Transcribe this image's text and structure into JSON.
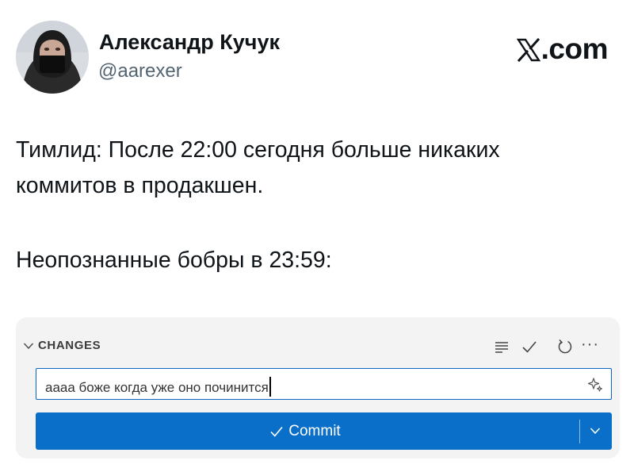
{
  "tweet": {
    "author": {
      "name": "Александр Кучук",
      "handle": "@aarexer"
    },
    "source": {
      "icon": "x-logo-icon",
      "suffix": ".com"
    },
    "text_lines": [
      "Тимлид: После 22:00 сегодня больше никаких",
      "коммитов в продакшен.",
      "Неопознанные бобры в 23:59:"
    ]
  },
  "scm_panel": {
    "section_title": "CHANGES",
    "toolbar": {
      "icons": [
        "view-as-list-icon",
        "checkmark-icon",
        "refresh-icon",
        "more-actions-icon"
      ],
      "more_glyph": "···"
    },
    "commit_message": {
      "value": "аааа боже когда уже оно починится",
      "icon": "sparkle-icon"
    },
    "commit_button": {
      "label": "Commit",
      "icon": "checkmark-icon",
      "dropdown_icon": "chevron-down-icon"
    },
    "colors": {
      "accent": "#0a6fc8",
      "panel_bg": "#f3f3f3",
      "input_border": "#0a66c2"
    }
  }
}
